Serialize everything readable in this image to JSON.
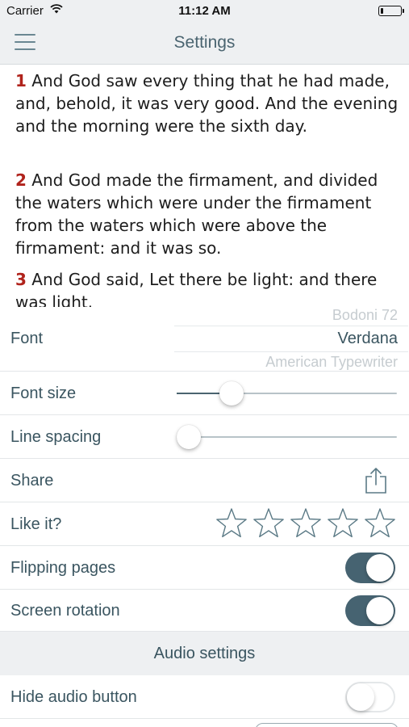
{
  "status_bar": {
    "carrier": "Carrier",
    "time": "11:12 AM",
    "battery_level": 0.12
  },
  "nav": {
    "title": "Settings",
    "menu_icon": "hamburger-menu-icon"
  },
  "reader": {
    "verses": [
      {
        "num": "1",
        "text": " And God saw every thing that he had made, and, behold, it was very good. And the evening and the morning were the sixth day."
      },
      {
        "num": "2",
        "text": " And God made the firmament, and divided the waters which were under the firmament from the waters which were above the firmament: and it was so."
      },
      {
        "num": "3",
        "text": " And God said, Let there be light: and there was light."
      }
    ]
  },
  "settings": {
    "font": {
      "label": "Font",
      "options_above": "Bodoni 72",
      "selected": "Verdana",
      "options_below": "American Typewriter"
    },
    "font_size": {
      "label": "Font size",
      "value": 0.25
    },
    "line_spacing": {
      "label": "Line spacing",
      "value": 0.0
    },
    "share": {
      "label": "Share",
      "icon": "share-icon"
    },
    "rating": {
      "label": "Like it?",
      "stars_filled": 0,
      "stars_total": 5
    },
    "flipping_pages": {
      "label": "Flipping pages",
      "on": true
    },
    "screen_rotation": {
      "label": "Screen rotation",
      "on": true
    },
    "audio_section": {
      "title": "Audio settings"
    },
    "hide_audio_button": {
      "label": "Hide audio button",
      "on": false
    }
  },
  "colors": {
    "accent": "#466371",
    "verse_number": "#b0231c",
    "bar_background": "#eef0f2"
  }
}
